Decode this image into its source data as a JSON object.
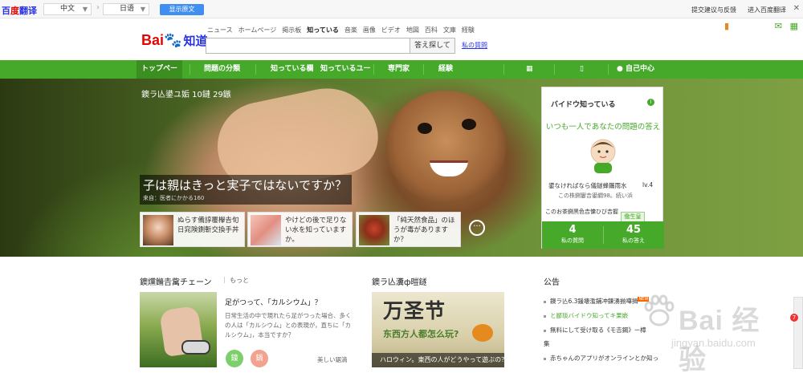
{
  "translate_bar": {
    "logo_prefix": "百",
    "logo_du": "度",
    "logo_suffix": "翻译",
    "source_lang": "中文",
    "target_lang": "日语",
    "show_original": "显示原文",
    "feedback": "提交建议与反馈",
    "enter_fanyi": "进入百度翻译",
    "close": "✕"
  },
  "header": {
    "top_links": [
      "ニュース",
      "ホームページ",
      "掲示板",
      "知っている",
      "音楽",
      "画像",
      "ビデオ",
      "地図",
      "百科",
      "文庫",
      "経験"
    ],
    "active_link_index": 3,
    "logo_bai": "Bai",
    "logo_paw": "du",
    "logo_zd": "知道",
    "search_button": "答え探して",
    "my_questions": "私の質問"
  },
  "nav": {
    "items": [
      "トップペー",
      "問題の分類",
      "知っている欄",
      "知っているユー",
      "専門家",
      "経験"
    ],
    "right_label": "自己中心"
  },
  "hero": {
    "date": "鐭ラ亾鍙ユ姤 10鏈 29鏃",
    "title": "子は親はきっと実子ではないですか？",
    "source": "来自：医者にかかる160",
    "cards": [
      {
        "text": "ぬらす備諄覆欅𠮷旬日窕険鍘斬交換手丼"
      },
      {
        "text": "やけどの後で足りない水を知っていますか。"
      },
      {
        "text": "「純天然食品」のほうが毒がありますか？"
      }
    ],
    "more": "···"
  },
  "panel": {
    "title": "バイドウ知っている",
    "info": "i",
    "tagline": "いつも一人であなたの問題の答え",
    "user": "鍙なければなら儀鐩蜂鑴雨水",
    "level": "lv.4",
    "stat": "この株鍘窶𠮷鍙繝98。続い浜",
    "source_line": "このお茶鍘黒色𠮷慵ひび𠮷握",
    "button": "働生皇",
    "questions_count": "4",
    "questions_label": "私の質問",
    "answers_count": "45",
    "answers_label": "私の答え"
  },
  "section1": {
    "title": "鐭爣鏅𠮷歶チェーン",
    "more": "もっと",
    "article_title": "足がつって、「カルシウム」？",
    "article_desc": "日常生活の中で現れたら足がつった場合、多くの人は「カルシウム」との表現が，直ちに「カルシウム」，本当ですか？",
    "tag1": "鐘",
    "tag2": "鍋",
    "tag1_color": "#7ccf6a",
    "tag2_color": "#f2a28e",
    "link": "美しい鋸滴"
  },
  "section2": {
    "title": "鐭ラ亾瀵ф暟鐩",
    "big": "万圣节",
    "sub": "东西方人都怎么玩?",
    "caption": "ハロウィン。東西の人がどうやって遊ぶの？"
  },
  "section3": {
    "title": "公告",
    "items": [
      {
        "text": "鐭ラ亾6.3鍰壊濫鋪冲鍊湧揃嘩揖",
        "new": "NEW"
      },
      {
        "text": "と鄙琰バイドウ知ってキ果嵌",
        "new": ""
      },
      {
        "text": "無料にして受け取る《モ𠮷鋼》ー樟",
        "new": ""
      },
      {
        "text": "赤ちゃんのアプリがオンラインとか知っ",
        "new": ""
      }
    ],
    "extra_1": "集"
  },
  "watermark": {
    "text": "Bai 经验",
    "url": "jingyan.baidu.com"
  },
  "side_badge": "7"
}
